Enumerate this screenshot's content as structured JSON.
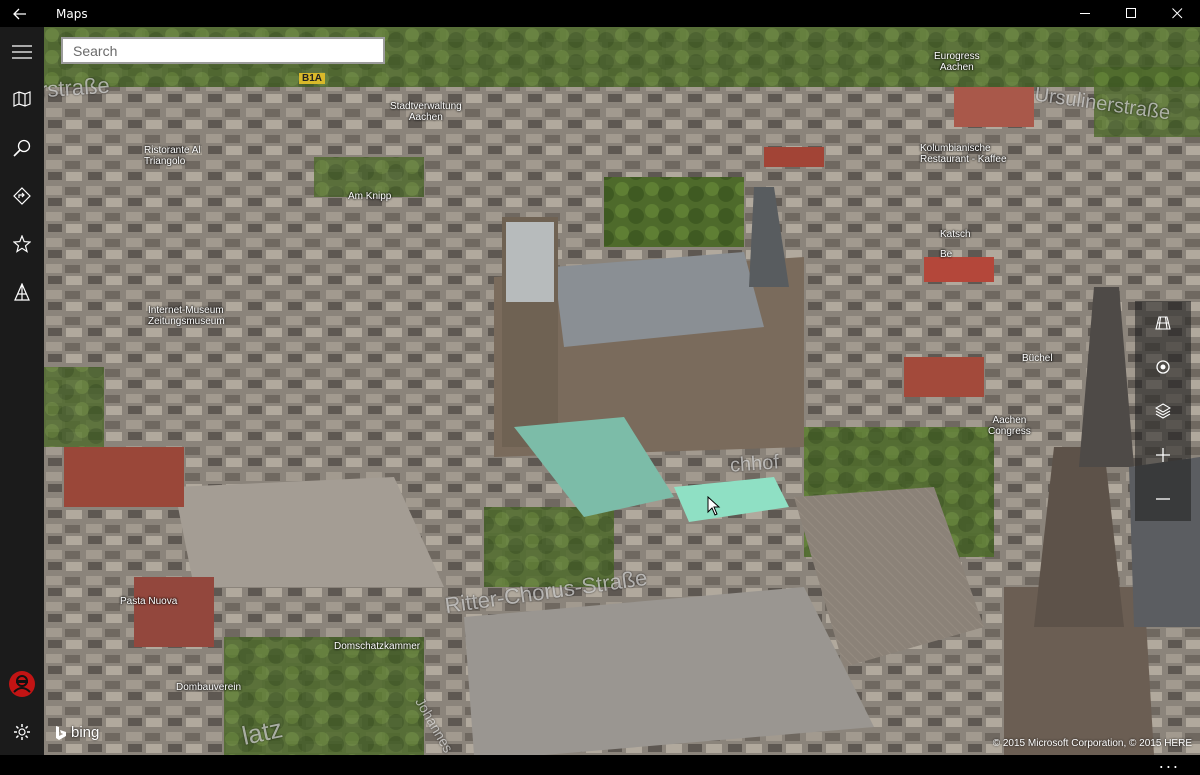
{
  "window": {
    "title": "Maps",
    "icons": {
      "back": "back-arrow-icon",
      "minimize": "minimize-icon",
      "maximize": "maximize-icon",
      "close": "close-icon"
    }
  },
  "search": {
    "placeholder": "Search"
  },
  "rail": {
    "items": [
      {
        "icon": "hamburger-icon"
      },
      {
        "icon": "map-icon"
      },
      {
        "icon": "search-icon"
      },
      {
        "icon": "directions-icon"
      },
      {
        "icon": "star-icon"
      },
      {
        "icon": "3d-cities-icon"
      },
      {
        "icon": "account-icon"
      },
      {
        "icon": "settings-icon"
      }
    ]
  },
  "map": {
    "labels": {
      "route_shield": "B1A",
      "eurogress": "Eurogress\nAachen",
      "stadtverwaltung": "Stadtverwaltung\nAachen",
      "ristorante": "Ristorante Al\nTriangolo",
      "am_knipp": "Am Knipp",
      "kolumbianische": "Kolumbianische\nRestaurant - Kaffee",
      "internet_museum": "Internet-Museum\nZeitungsmuseum",
      "aachen_congress": "Aachen\nCongress",
      "domschatzkammer": "Domschatzkammer",
      "pasta": "Pasta Nuova",
      "dombauverein": "Dombauverein",
      "buchel": "Büchel",
      "katsch": "Katsch",
      "fragment": "Be"
    },
    "streets": {
      "top_left": "rstraße",
      "top_right": "Ursulinerstraße",
      "ritter": "Ritter-Chorus-Straße",
      "markt": "chhof",
      "bottom": "latz",
      "johannes": "Johannes"
    },
    "controls": [
      {
        "icon": "streetside-icon"
      },
      {
        "icon": "locate-icon"
      },
      {
        "icon": "layers-icon"
      },
      {
        "icon": "zoom-in-icon"
      },
      {
        "icon": "zoom-out-icon"
      }
    ],
    "brand": "bing",
    "copyright": "© 2015 Microsoft Corporation, © 2015 HERE"
  },
  "status": {
    "more": "..."
  }
}
